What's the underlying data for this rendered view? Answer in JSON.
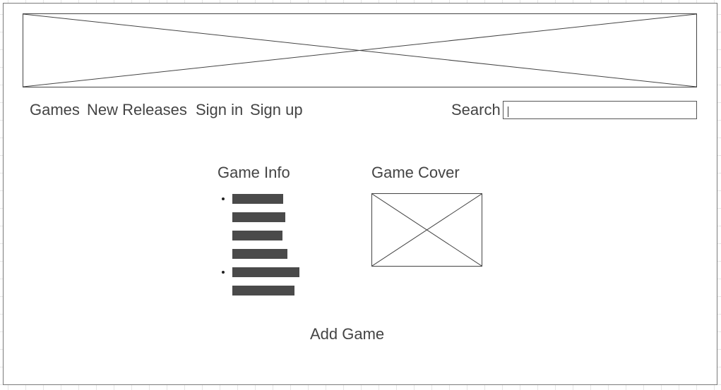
{
  "nav": {
    "games": "Games",
    "new_releases": "New Releases",
    "sign_in": "Sign in",
    "sign_up": "Sign up"
  },
  "search": {
    "label": "Search",
    "value": ""
  },
  "main": {
    "game_info_title": "Game Info",
    "game_cover_title": "Game Cover",
    "add_game_label": "Add Game"
  }
}
